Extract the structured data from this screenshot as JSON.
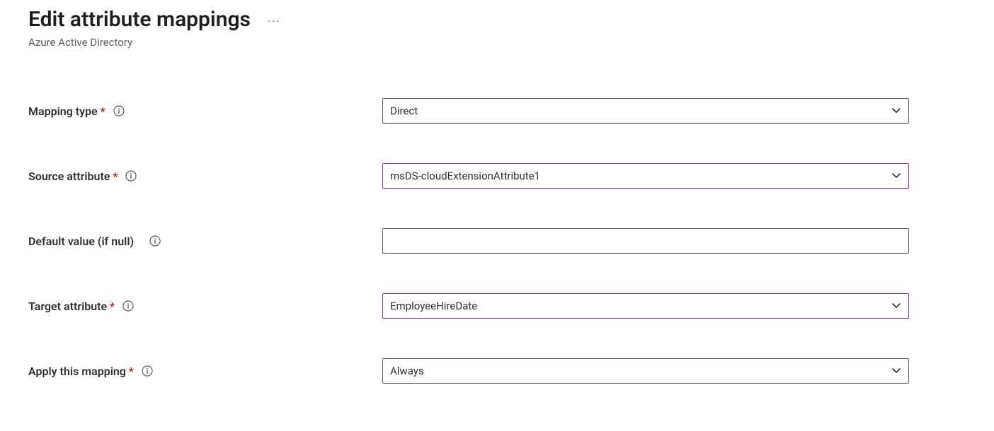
{
  "header": {
    "title": "Edit attribute mappings",
    "subtitle": "Azure Active Directory"
  },
  "fields": {
    "mapping_type": {
      "label": "Mapping type",
      "required": true,
      "value": "Direct"
    },
    "source_attr": {
      "label": "Source attribute",
      "required": true,
      "value": "msDS-cloudExtensionAttribute1"
    },
    "default_value": {
      "label": "Default value (if null)",
      "required": false,
      "value": ""
    },
    "target_attr": {
      "label": "Target attribute",
      "required": true,
      "value": "EmployeeHireDate"
    },
    "apply_mapping": {
      "label": "Apply this mapping",
      "required": true,
      "value": "Always"
    }
  }
}
